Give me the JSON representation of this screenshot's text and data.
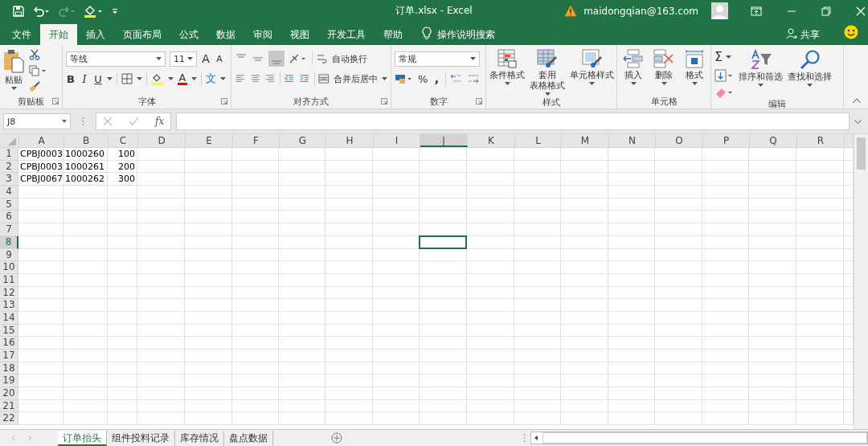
{
  "title_bar": {
    "title": "订单.xlsx  -  Excel",
    "account": "maidongqian@163.com"
  },
  "ribbon_tabs": [
    {
      "label": "文件",
      "selected": false
    },
    {
      "label": "开始",
      "selected": true
    },
    {
      "label": "插入",
      "selected": false
    },
    {
      "label": "页面布局",
      "selected": false
    },
    {
      "label": "公式",
      "selected": false
    },
    {
      "label": "数据",
      "selected": false
    },
    {
      "label": "审阅",
      "selected": false
    },
    {
      "label": "视图",
      "selected": false
    },
    {
      "label": "开发工具",
      "selected": false
    },
    {
      "label": "帮助",
      "selected": false
    }
  ],
  "tell_me": "操作说明搜索",
  "share": "共享",
  "clipboard": {
    "paste": "粘贴",
    "group": "剪贴板"
  },
  "font": {
    "name": "等线",
    "size": "11",
    "grow": "A",
    "shrink": "A",
    "bold": "B",
    "italic": "I",
    "underline": "U",
    "color_button": "A",
    "phonetic": "文",
    "group": "字体"
  },
  "alignment": {
    "wrap": "自动换行",
    "merge": "合并后居中",
    "group": "对齐方式"
  },
  "number": {
    "format": "常规",
    "percent": "%",
    "comma": ",",
    "group": "数字"
  },
  "styles": {
    "buttons": [
      [
        "条件格式"
      ],
      [
        "套用",
        "表格格式"
      ],
      [
        "单元格样式"
      ]
    ],
    "group": "样式"
  },
  "cells": {
    "buttons": [
      "插入",
      "删除",
      "格式"
    ],
    "group": "单元格"
  },
  "editing": {
    "sum": "Σ",
    "sort": "排序和筛选",
    "find": "查找和选择",
    "group": "编辑"
  },
  "formula_bar": {
    "name_box": "J8",
    "fx": "fx"
  },
  "columns": [
    {
      "label": "A",
      "selected": false
    },
    {
      "label": "B",
      "selected": false
    },
    {
      "label": "C",
      "selected": false
    },
    {
      "label": "D",
      "selected": false
    },
    {
      "label": "E",
      "selected": false
    },
    {
      "label": "F",
      "selected": false
    },
    {
      "label": "G",
      "selected": false
    },
    {
      "label": "H",
      "selected": false
    },
    {
      "label": "I",
      "selected": false
    },
    {
      "label": "J",
      "selected": true
    },
    {
      "label": "K",
      "selected": false
    },
    {
      "label": "L",
      "selected": false
    },
    {
      "label": "M",
      "selected": false
    },
    {
      "label": "N",
      "selected": false
    },
    {
      "label": "O",
      "selected": false
    },
    {
      "label": "P",
      "selected": false
    },
    {
      "label": "Q",
      "selected": false
    },
    {
      "label": "R",
      "selected": false
    }
  ],
  "rows": [
    {
      "label": "1",
      "selected": false,
      "cells": [
        {
          "value": "CPBJ0003",
          "kind": "text"
        },
        {
          "value": "1000260",
          "kind": "text"
        },
        {
          "value": "100",
          "kind": "number"
        }
      ]
    },
    {
      "label": "2",
      "selected": false,
      "cells": [
        {
          "value": "CPBJ0003",
          "kind": "text"
        },
        {
          "value": "1000261",
          "kind": "text"
        },
        {
          "value": "200",
          "kind": "number"
        }
      ]
    },
    {
      "label": "3",
      "selected": false,
      "cells": [
        {
          "value": "CPBJ0067",
          "kind": "text"
        },
        {
          "value": "1000262",
          "kind": "text"
        },
        {
          "value": "300",
          "kind": "number"
        }
      ]
    },
    {
      "label": "4",
      "selected": false
    },
    {
      "label": "5",
      "selected": false
    },
    {
      "label": "6",
      "selected": false
    },
    {
      "label": "7",
      "selected": false
    },
    {
      "label": "8",
      "selected": true
    },
    {
      "label": "9",
      "selected": false
    },
    {
      "label": "10",
      "selected": false
    },
    {
      "label": "11",
      "selected": false
    },
    {
      "label": "12",
      "selected": false
    },
    {
      "label": "13",
      "selected": false
    },
    {
      "label": "14",
      "selected": false
    },
    {
      "label": "15",
      "selected": false
    },
    {
      "label": "16",
      "selected": false
    },
    {
      "label": "17",
      "selected": false
    },
    {
      "label": "18",
      "selected": false
    },
    {
      "label": "19",
      "selected": false
    },
    {
      "label": "20",
      "selected": false
    },
    {
      "label": "21",
      "selected": false
    },
    {
      "label": "22",
      "selected": false
    }
  ],
  "sheet_tabs": [
    {
      "label": "订单抬头",
      "selected": true
    },
    {
      "label": "组件投料记录",
      "selected": false
    },
    {
      "label": "库存情况",
      "selected": false
    },
    {
      "label": "盘点数据",
      "selected": false
    }
  ]
}
